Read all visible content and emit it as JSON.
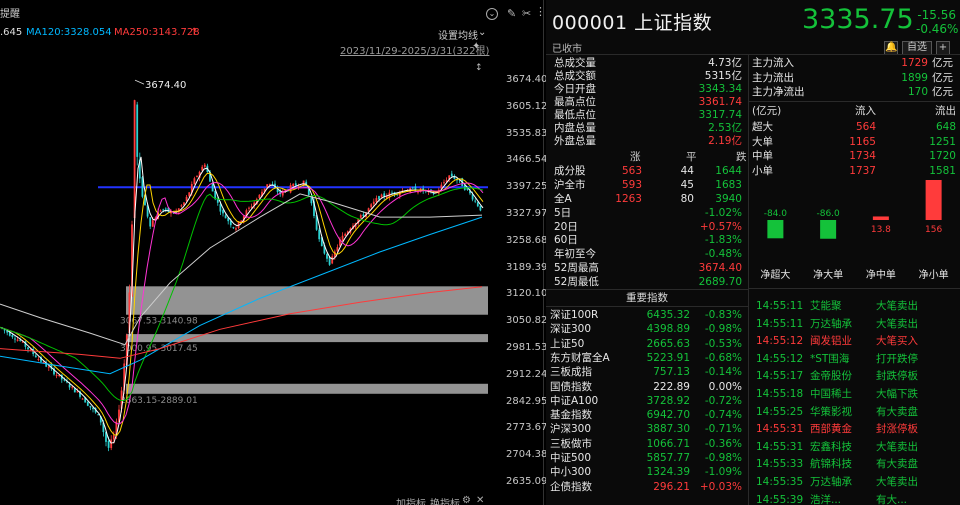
{
  "header": {
    "partial_left": "提醒",
    "ma_left_value": ".645",
    "ma120_label": "MA120:3328.054",
    "ma250_label": "MA250:3143.728",
    "ma250_arrow": "↑",
    "settings_label": "设置均线",
    "date_range": "2023/11/29-2025/3/31(322根)"
  },
  "chart_data": {
    "type": "candlestick",
    "y_ticks": [
      "3674.40",
      "3605.12",
      "3535.83",
      "3466.54",
      "3397.25",
      "3327.97",
      "3258.68",
      "3189.39",
      "3120.10",
      "3050.82",
      "2981.53",
      "2912.24",
      "2842.95",
      "2773.67",
      "2704.38",
      "2635.09"
    ],
    "ylim": [
      2635.09,
      3674.4
    ],
    "peak_label": "3674.40",
    "price_zones": [
      {
        "label": "3067.53-3140.98",
        "low": 3067.53,
        "high": 3140.98
      },
      {
        "label": "3000.95-3017.45",
        "low": 3000.95,
        "high": 3017.45
      },
      {
        "label": "2863.15-2889.01",
        "low": 2863.15,
        "high": 2889.01
      }
    ],
    "horizontal_line": 3397.25,
    "series_colors": {
      "candle_up": "#ff3b3b",
      "candle_down": "#2bd3d3",
      "ma5": "#ffffff",
      "ma10": "#ffd400",
      "ma20": "#ff34d5",
      "ma60": "#00c000",
      "ma120": "#00b8ff",
      "ma250": "#ff3b3b",
      "ma_long": "#cfcfcf",
      "line": "#2233ff"
    }
  },
  "bottom_tabs": [
    "加指标",
    "换指标"
  ],
  "quote": {
    "code": "000001",
    "name": "上证指数",
    "status": "已收市",
    "price": "3335.75",
    "change": "-15.56",
    "change_pct": "-0.46%",
    "selfselect": "自选",
    "selfselect_plus": "+",
    "stats": [
      {
        "label": "总成交量",
        "value": "4.73亿",
        "color": "wht"
      },
      {
        "label": "总成交额",
        "value": "5315亿",
        "color": "wht"
      },
      {
        "label": "今日开盘",
        "value": "3343.34",
        "color": "grn"
      },
      {
        "label": "最高点位",
        "value": "3361.74",
        "color": "red"
      },
      {
        "label": "最低点位",
        "value": "3317.74",
        "color": "grn"
      },
      {
        "label": "内盘总量",
        "value": "2.53亿",
        "color": "grn"
      },
      {
        "label": "外盘总量",
        "value": "2.19亿",
        "color": "red"
      }
    ],
    "breadth_header": [
      "涨",
      "平",
      "跌"
    ],
    "breadth": [
      {
        "label": "成分股",
        "up": "563",
        "flat": "44",
        "down": "1644"
      },
      {
        "label": "沪全市",
        "up": "593",
        "flat": "45",
        "down": "1683"
      },
      {
        "label": "全A",
        "up": "1263",
        "flat": "80",
        "down": "3940"
      }
    ],
    "periods": [
      {
        "label": "5日",
        "value": "-1.02%",
        "color": "grn"
      },
      {
        "label": "20日",
        "value": "+0.57%",
        "color": "red"
      },
      {
        "label": "60日",
        "value": "-1.83%",
        "color": "grn"
      },
      {
        "label": "年初至今",
        "value": "-0.48%",
        "color": "grn"
      },
      {
        "label": "52周最高",
        "value": "3674.40",
        "color": "red"
      },
      {
        "label": "52周最低",
        "value": "2689.70",
        "color": "grn"
      }
    ]
  },
  "indices": {
    "title": "重要指数",
    "rows": [
      {
        "name": "深证100R",
        "value": "6435.32",
        "pct": "-0.83%",
        "color": "grn"
      },
      {
        "name": "深证300",
        "value": "4398.89",
        "pct": "-0.98%",
        "color": "grn"
      },
      {
        "name": "上证50",
        "value": "2665.63",
        "pct": "-0.53%",
        "color": "grn"
      },
      {
        "name": "东方财富全A",
        "value": "5223.91",
        "pct": "-0.68%",
        "color": "grn"
      },
      {
        "name": "三板成指",
        "value": "757.13",
        "pct": "-0.14%",
        "color": "grn"
      },
      {
        "name": "国债指数",
        "value": "222.89",
        "pct": "0.00%",
        "color": "wht"
      },
      {
        "name": "中证A100",
        "value": "3728.92",
        "pct": "-0.72%",
        "color": "grn"
      },
      {
        "name": "基金指数",
        "value": "6942.70",
        "pct": "-0.74%",
        "color": "grn"
      },
      {
        "name": "沪深300",
        "value": "3887.30",
        "pct": "-0.71%",
        "color": "grn"
      },
      {
        "name": "三板做市",
        "value": "1066.71",
        "pct": "-0.36%",
        "color": "grn"
      },
      {
        "name": "中证500",
        "value": "5857.77",
        "pct": "-0.98%",
        "color": "grn"
      },
      {
        "name": "中小300",
        "value": "1324.39",
        "pct": "-1.09%",
        "color": "grn"
      },
      {
        "name": "企债指数",
        "value": "296.21",
        "pct": "+0.03%",
        "color": "red"
      }
    ]
  },
  "fund_flow": {
    "summary": [
      {
        "label": "主力流入",
        "value": "1729",
        "unit": "亿元",
        "color": "red"
      },
      {
        "label": "主力流出",
        "value": "1899",
        "unit": "亿元",
        "color": "grn"
      },
      {
        "label": "主力净流出",
        "value": "170",
        "unit": "亿元",
        "color": "grn"
      }
    ],
    "table_header": [
      "(亿元)",
      "流入",
      "流出"
    ],
    "table": [
      {
        "label": "超大",
        "in": "564",
        "out": "648"
      },
      {
        "label": "大单",
        "in": "1165",
        "out": "1251"
      },
      {
        "label": "中单",
        "in": "1734",
        "out": "1720"
      },
      {
        "label": "小单",
        "in": "1737",
        "out": "1581"
      }
    ],
    "net_bars": [
      {
        "label": "净超大",
        "value": -84.0,
        "value_text": "-84.0"
      },
      {
        "label": "净大单",
        "value": -86.0,
        "value_text": "-86.0"
      },
      {
        "label": "净中单",
        "value": 13.8,
        "value_text": "13.8"
      },
      {
        "label": "净小单",
        "value": 156,
        "value_text": "156"
      }
    ]
  },
  "tape": [
    {
      "time": "14:55:11",
      "name": "艾能聚",
      "type": "大笔卖出",
      "color": "grn"
    },
    {
      "time": "14:55:11",
      "name": "万达轴承",
      "type": "大笔卖出",
      "color": "grn"
    },
    {
      "time": "14:55:12",
      "name": "闽发铝业",
      "type": "大笔买入",
      "color": "red"
    },
    {
      "time": "14:55:12",
      "name": "*ST围海",
      "type": "打开跌停",
      "color": "grn"
    },
    {
      "time": "14:55:17",
      "name": "金帝股份",
      "type": "封跌停板",
      "color": "grn"
    },
    {
      "time": "14:55:18",
      "name": "中国稀土",
      "type": "大幅下跌",
      "color": "grn"
    },
    {
      "time": "14:55:25",
      "name": "华策影视",
      "type": "有大卖盘",
      "color": "grn"
    },
    {
      "time": "14:55:31",
      "name": "西部黄金",
      "type": "封涨停板",
      "color": "red"
    },
    {
      "time": "14:55:31",
      "name": "宏鑫科技",
      "type": "大笔卖出",
      "color": "grn"
    },
    {
      "time": "14:55:33",
      "name": "航锦科技",
      "type": "有大卖盘",
      "color": "grn"
    },
    {
      "time": "14:55:35",
      "name": "万达轴承",
      "type": "大笔卖出",
      "color": "grn"
    },
    {
      "time": "14:55:39",
      "name": "浩洋...",
      "type": "有大...",
      "color": "grn"
    }
  ]
}
